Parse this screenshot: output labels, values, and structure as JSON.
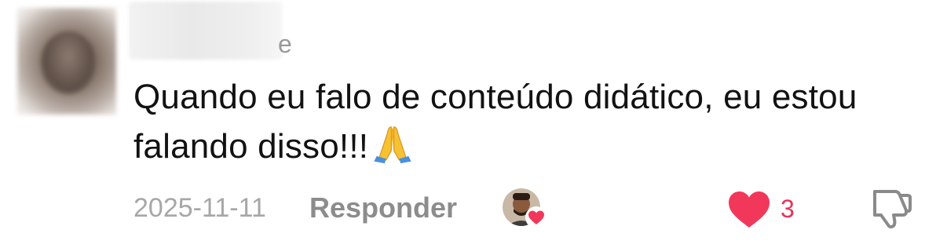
{
  "comment": {
    "username_visible_suffix": "e",
    "text": "Quando eu falo de conteúdo didático, eu estou falando disso!!!",
    "emoji": "folded-hands",
    "date": "2025-11-11",
    "reply_label": "Responder",
    "like_count": "3",
    "liked_by_creator": true
  },
  "colors": {
    "text": "#121212",
    "muted": "#a7a7a7",
    "reply": "#8c8c8c",
    "like": "#f2385a",
    "like_count": "#e8325a"
  }
}
